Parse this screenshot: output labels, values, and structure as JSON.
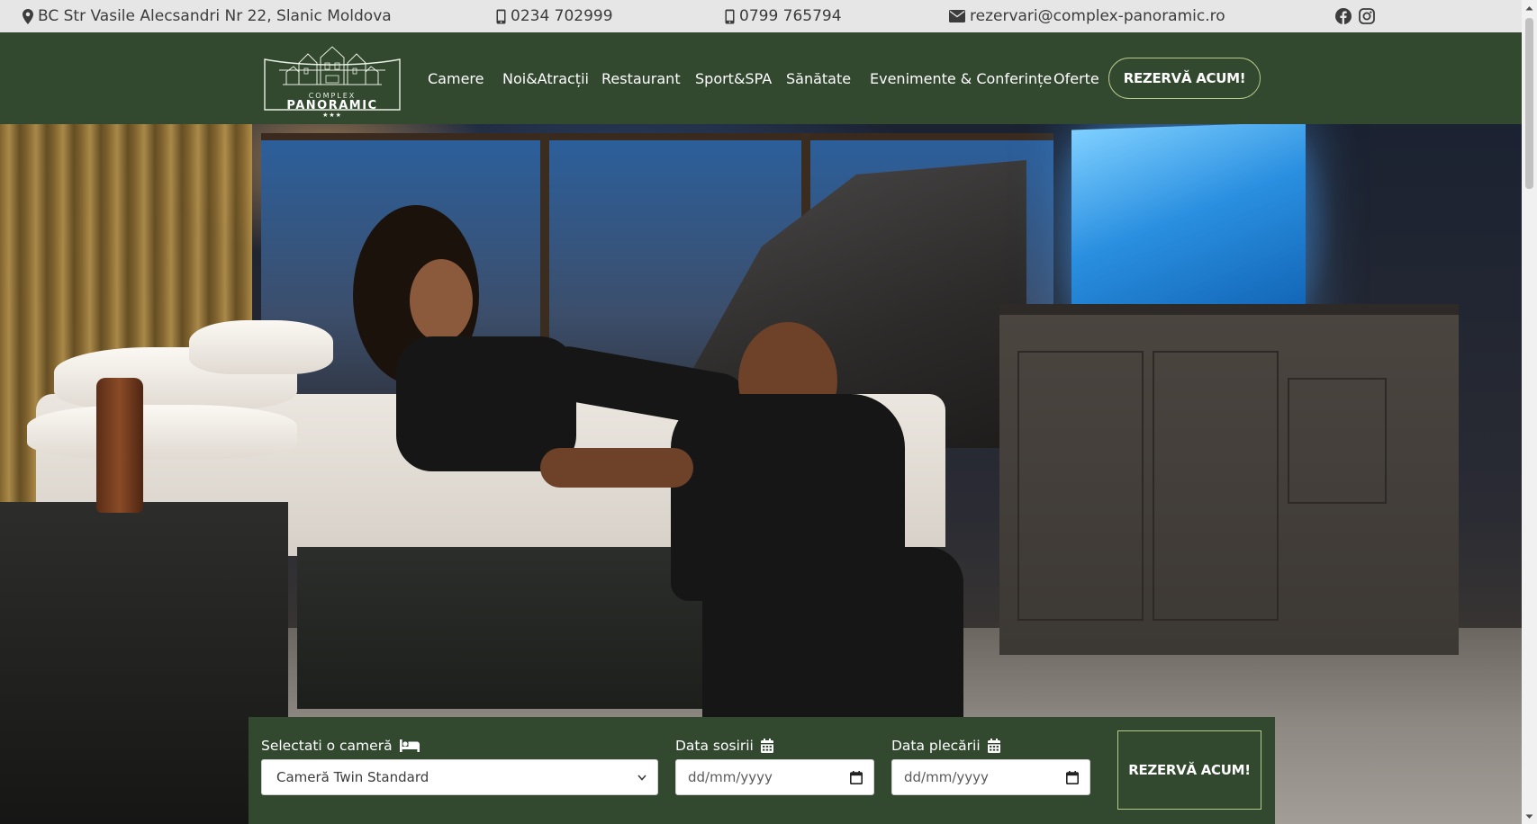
{
  "topbar": {
    "address": "BC Str Vasile Alecsandri Nr 22, Slanic Moldova",
    "phone_1": "0234 702999",
    "phone_2": "0799 765794",
    "email": "rezervari@complex-panoramic.ro",
    "icons": {
      "address": "map-pin-icon",
      "phone_1": "mobile-phone-icon",
      "phone_2": "mobile-phone-icon",
      "email": "envelope-icon",
      "facebook": "facebook-icon",
      "instagram": "instagram-icon"
    }
  },
  "header": {
    "logo_top": "COMPLEX",
    "logo_name": "PANORAMIC",
    "logo_stars": "★★★",
    "nav": [
      {
        "label": "Camere"
      },
      {
        "label": "Noi&Atracții"
      },
      {
        "label": "Restaurant"
      },
      {
        "label": "Sport&SPA"
      },
      {
        "label": "Sănătate"
      },
      {
        "label": "Evenimente & Conferințe"
      },
      {
        "label": "Oferte"
      }
    ],
    "cta_label": "REZERVĂ ACUM!"
  },
  "booking": {
    "room_label": "Selectati o cameră",
    "room_icon": "bed-icon",
    "room_value": "Cameră Twin Standard",
    "arrival_label": "Data sosirii",
    "arrival_placeholder": "dd/mm/yyyy",
    "departure_label": "Data plecării",
    "departure_placeholder": "dd/mm/yyyy",
    "calendar_icon": "calendar-icon",
    "cta_label": "REZERVĂ ACUM!"
  },
  "colors": {
    "brand_green": "#324930",
    "accent_outline": "#b7c889",
    "topbar_bg": "#e6e6e6"
  }
}
